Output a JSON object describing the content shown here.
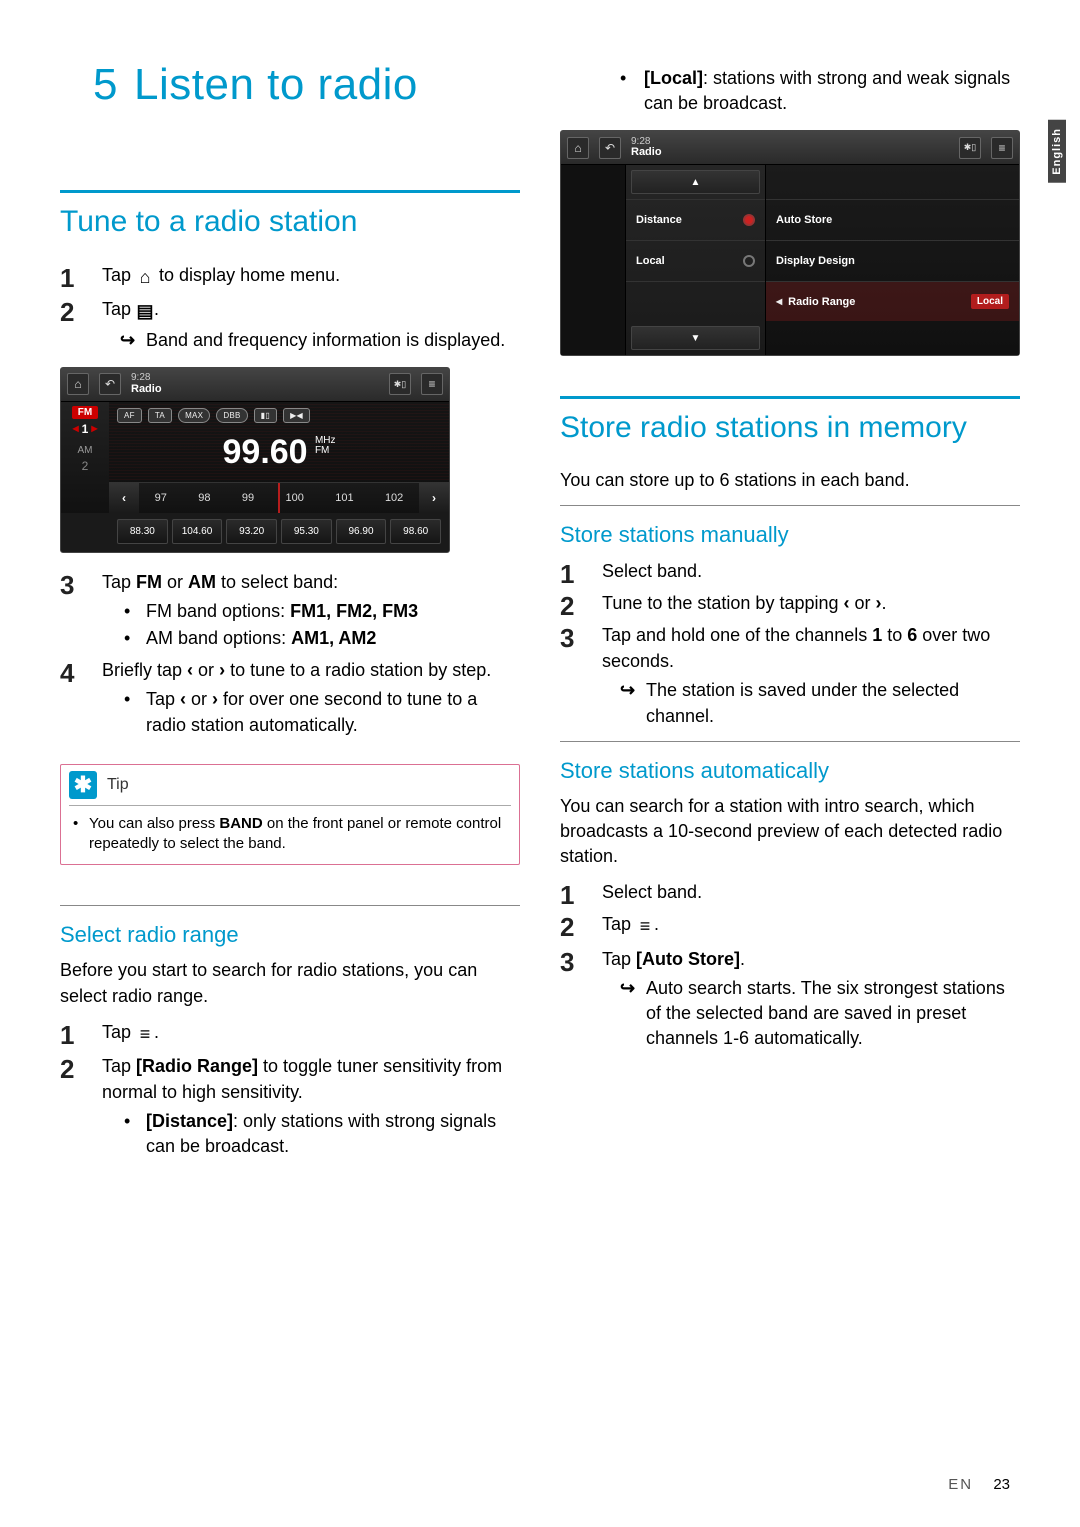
{
  "chapter": {
    "number": "5",
    "title": "Listen to radio"
  },
  "side_tab": "English",
  "footer": {
    "lang": "EN",
    "page": "23"
  },
  "col1": {
    "section1_title": "Tune to a radio station",
    "steps1": {
      "s1_a": "Tap ",
      "s1_b": " to display home menu.",
      "s2_a": "Tap ",
      "s2_b": ".",
      "s2_sub": "Band and frequency information is displayed.",
      "s3_a": "Tap ",
      "s3_fm": "FM",
      "s3_or": " or ",
      "s3_am": "AM",
      "s3_b": " to select band:",
      "s3_sub1_a": "FM band options: ",
      "s3_sub1_b": "FM1, FM2, FM3",
      "s3_sub2_a": "AM band options: ",
      "s3_sub2_b": "AM1, AM2",
      "s4_a": "Briefly tap ",
      "s4_lt": "‹",
      "s4_or": " or ",
      "s4_gt": "›",
      "s4_b": " to tune to a radio station by step.",
      "s4_sub_a": "Tap ",
      "s4_sub_lt": "‹",
      "s4_sub_or": " or ",
      "s4_sub_gt": "›",
      "s4_sub_b": " for over one second to tune to a radio station automatically."
    },
    "tip": {
      "label": "Tip",
      "body_a": "You can also press ",
      "body_b": "BAND",
      "body_c": " on the front panel or remote control repeatedly to select the band."
    },
    "section2_title": "Select radio range",
    "section2_intro": "Before you start to search for radio stations, you can select radio range.",
    "steps2": {
      "s1_a": "Tap ",
      "s1_b": ".",
      "s2_a": "Tap ",
      "s2_b": "[Radio Range]",
      "s2_c": " to toggle tuner sensitivity from normal to high sensitivity.",
      "s2_sub_a": "[Distance]",
      "s2_sub_b": ": only stations with strong signals can be broadcast."
    }
  },
  "col2": {
    "top_bullet_a": "[Local]",
    "top_bullet_b": ": stations with strong and weak signals can be broadcast.",
    "section1_title": "Store radio stations in memory",
    "section1_intro": "You can store up to 6 stations in each band.",
    "sub1_title": "Store stations manually",
    "steps_manual": {
      "s1": "Select band.",
      "s2_a": "Tune to the station by tapping ",
      "s2_lt": "‹",
      "s2_or": " or ",
      "s2_gt": "›",
      "s2_b": ".",
      "s3_a": "Tap and hold one of the channels ",
      "s3_b": "1",
      "s3_c": " to ",
      "s3_d": "6",
      "s3_e": " over two seconds.",
      "s3_sub": "The station is saved under the selected channel."
    },
    "sub2_title": "Store stations automatically",
    "sub2_intro": "You can search for a station with intro search, which broadcasts a 10-second preview of each detected radio station.",
    "steps_auto": {
      "s1": "Select band.",
      "s2_a": "Tap ",
      "s2_b": ".",
      "s3_a": "Tap ",
      "s3_b": "[Auto Store]",
      "s3_c": ".",
      "s3_sub": "Auto search starts. The six strongest stations of the selected band are saved in preset channels 1-6 automatically."
    }
  },
  "device1": {
    "time": "9:28",
    "title": "Radio",
    "fm": "FM",
    "fm_num": "1",
    "am": "AM",
    "am_num": "2",
    "badges": [
      "AF",
      "TA",
      "MAX",
      "DBB",
      "▮▯",
      "▶◀"
    ],
    "freq": "99.60",
    "unit_top": "MHz",
    "unit_bot": "FM",
    "dial": [
      "97",
      "98",
      "99",
      "100",
      "101",
      "102"
    ],
    "presets": [
      "88.30",
      "104.60",
      "93.20",
      "95.30",
      "96.90",
      "98.60"
    ]
  },
  "device2": {
    "time": "9:28",
    "title": "Radio",
    "left_items": [
      {
        "label": "Distance",
        "on": true
      },
      {
        "label": "Local",
        "on": false
      }
    ],
    "right_items": [
      "Auto Store",
      "Display Design"
    ],
    "right_active": "Radio Range",
    "right_pill": "Local"
  }
}
